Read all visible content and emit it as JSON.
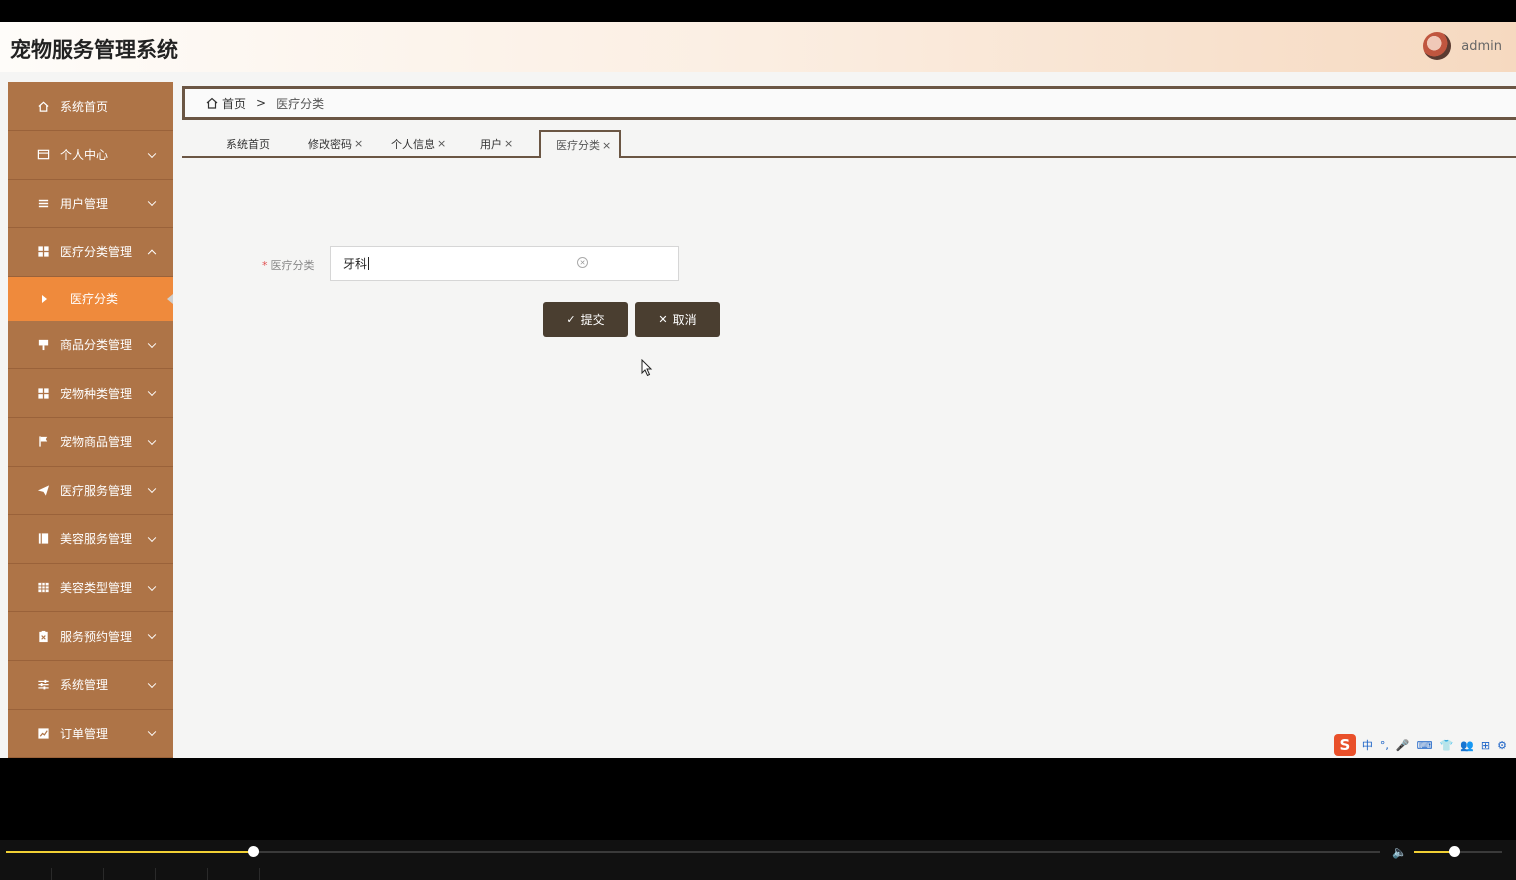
{
  "header": {
    "title": "宠物服务管理系统",
    "user": "admin"
  },
  "sidebar": {
    "items": [
      {
        "label": "系统首页",
        "icon": "home-icon",
        "arrow": ""
      },
      {
        "label": "个人中心",
        "icon": "id-card-icon",
        "arrow": "down"
      },
      {
        "label": "用户管理",
        "icon": "list-icon",
        "arrow": "down"
      },
      {
        "label": "医疗分类管理",
        "icon": "grid-icon",
        "arrow": "up"
      },
      {
        "label": "商品分类管理",
        "icon": "signpost-icon",
        "arrow": "down"
      },
      {
        "label": "宠物种类管理",
        "icon": "grid-icon",
        "arrow": "down"
      },
      {
        "label": "宠物商品管理",
        "icon": "flag-icon",
        "arrow": "down"
      },
      {
        "label": "医疗服务管理",
        "icon": "paper-plane-icon",
        "arrow": "down"
      },
      {
        "label": "美容服务管理",
        "icon": "book-icon",
        "arrow": "down"
      },
      {
        "label": "美容类型管理",
        "icon": "table-icon",
        "arrow": "down"
      },
      {
        "label": "服务预约管理",
        "icon": "clipboard-icon",
        "arrow": "down"
      },
      {
        "label": "系统管理",
        "icon": "sliders-icon",
        "arrow": "down"
      },
      {
        "label": "订单管理",
        "icon": "chart-icon",
        "arrow": "down"
      }
    ],
    "active_sub": "医疗分类"
  },
  "breadcrumb": {
    "home": "首页",
    "separator": ">",
    "current": "医疗分类"
  },
  "tabs": [
    {
      "label": "系统首页",
      "closable": false
    },
    {
      "label": "修改密码",
      "closable": true
    },
    {
      "label": "个人信息",
      "closable": true
    },
    {
      "label": "用户",
      "closable": true
    },
    {
      "label": "医疗分类",
      "closable": true,
      "active": true
    }
  ],
  "tab_close_glyph": "×",
  "form": {
    "required_mark": "*",
    "label": "医疗分类",
    "value": "牙科",
    "submit_label": "提交",
    "cancel_label": "取消"
  },
  "ime": {
    "items": [
      "中",
      "°,",
      "🎤",
      "⌨",
      "👕",
      "👥",
      "⊞",
      "⚙"
    ]
  },
  "player": {
    "progress": 0.18,
    "volume": 0.45
  },
  "colors": {
    "sidebar": "#ae7447",
    "sidebar_active": "#ef8a3c",
    "button": "#4a3e30",
    "accent_border": "#6b5644"
  }
}
